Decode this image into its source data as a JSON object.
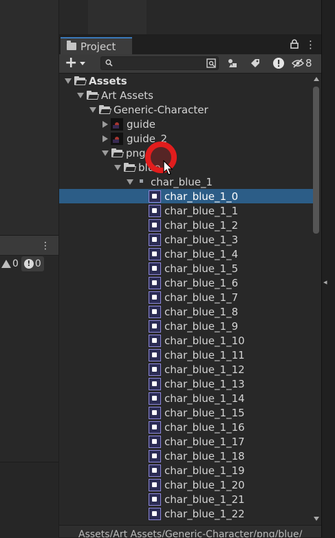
{
  "project_window": {
    "tab_label": "Project",
    "search_placeholder": "",
    "hidden_count": "8"
  },
  "console": {
    "warning_count": "0",
    "error_count": "0"
  },
  "tree": [
    {
      "label": "Assets",
      "depth": 0,
      "kind": "folder",
      "expanded": true,
      "bold": true
    },
    {
      "label": "Art Assets",
      "depth": 1,
      "kind": "folder",
      "expanded": true
    },
    {
      "label": "Generic-Character",
      "depth": 2,
      "kind": "folder",
      "expanded": true
    },
    {
      "label": "guide",
      "depth": 3,
      "kind": "image",
      "expanded": false
    },
    {
      "label": "guide_2",
      "depth": 3,
      "kind": "image",
      "expanded": false
    },
    {
      "label": "png",
      "depth": 3,
      "kind": "folder",
      "expanded": true
    },
    {
      "label": "blue",
      "depth": 4,
      "kind": "folder",
      "expanded": true
    },
    {
      "label": "char_blue_1",
      "depth": 5,
      "kind": "sheet",
      "expanded": true
    },
    {
      "label": "char_blue_1_0",
      "depth": 6,
      "kind": "sprite",
      "selected": true
    },
    {
      "label": "char_blue_1_1",
      "depth": 6,
      "kind": "sprite"
    },
    {
      "label": "char_blue_1_2",
      "depth": 6,
      "kind": "sprite"
    },
    {
      "label": "char_blue_1_3",
      "depth": 6,
      "kind": "sprite"
    },
    {
      "label": "char_blue_1_4",
      "depth": 6,
      "kind": "sprite"
    },
    {
      "label": "char_blue_1_5",
      "depth": 6,
      "kind": "sprite"
    },
    {
      "label": "char_blue_1_6",
      "depth": 6,
      "kind": "sprite"
    },
    {
      "label": "char_blue_1_7",
      "depth": 6,
      "kind": "sprite"
    },
    {
      "label": "char_blue_1_8",
      "depth": 6,
      "kind": "sprite"
    },
    {
      "label": "char_blue_1_9",
      "depth": 6,
      "kind": "sprite"
    },
    {
      "label": "char_blue_1_10",
      "depth": 6,
      "kind": "sprite"
    },
    {
      "label": "char_blue_1_11",
      "depth": 6,
      "kind": "sprite"
    },
    {
      "label": "char_blue_1_12",
      "depth": 6,
      "kind": "sprite"
    },
    {
      "label": "char_blue_1_13",
      "depth": 6,
      "kind": "sprite"
    },
    {
      "label": "char_blue_1_14",
      "depth": 6,
      "kind": "sprite"
    },
    {
      "label": "char_blue_1_15",
      "depth": 6,
      "kind": "sprite"
    },
    {
      "label": "char_blue_1_16",
      "depth": 6,
      "kind": "sprite"
    },
    {
      "label": "char_blue_1_17",
      "depth": 6,
      "kind": "sprite"
    },
    {
      "label": "char_blue_1_18",
      "depth": 6,
      "kind": "sprite"
    },
    {
      "label": "char_blue_1_19",
      "depth": 6,
      "kind": "sprite"
    },
    {
      "label": "char_blue_1_20",
      "depth": 6,
      "kind": "sprite"
    },
    {
      "label": "char_blue_1_21",
      "depth": 6,
      "kind": "sprite"
    },
    {
      "label": "char_blue_1_22",
      "depth": 6,
      "kind": "sprite"
    }
  ],
  "status_path": "Assets/Art Assets/Generic-Character/png/blue/",
  "colors": {
    "selection": "#2c5d87",
    "click_marker": "#e11d1d",
    "tab_accent": "#3a79bb"
  }
}
